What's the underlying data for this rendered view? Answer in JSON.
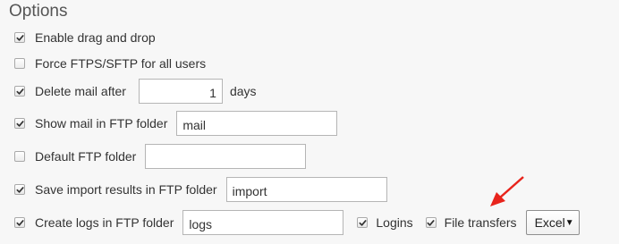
{
  "title": "Options",
  "options": {
    "drag_drop": {
      "label": "Enable drag and drop",
      "checked": true
    },
    "force_ftps": {
      "label": "Force FTPS/SFTP for all users",
      "checked": false
    },
    "delete_mail": {
      "label": "Delete mail after",
      "checked": true,
      "value": "1",
      "suffix": "days"
    },
    "show_mail": {
      "label": "Show mail in FTP folder",
      "checked": true,
      "value": "mail"
    },
    "default_ftp": {
      "label": "Default FTP folder",
      "checked": false,
      "value": ""
    },
    "save_import": {
      "label": "Save import results in FTP folder",
      "checked": true,
      "value": "import"
    },
    "create_logs": {
      "label": "Create logs in FTP folder",
      "checked": true,
      "value": "logs",
      "logins": {
        "label": "Logins",
        "checked": true
      },
      "file_transfers": {
        "label": "File transfers",
        "checked": true
      },
      "format": {
        "selected": "Excel"
      }
    }
  },
  "annotation": {
    "arrow_color": "#e8241c"
  }
}
